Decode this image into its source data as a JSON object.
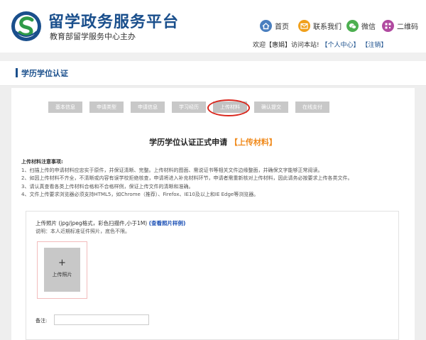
{
  "header": {
    "site_title": "留学政务服务平台",
    "site_subtitle": "教育部留学服务中心主办",
    "nav": [
      {
        "label": "首页",
        "icon": "home-icon",
        "color": "#4a7fbf"
      },
      {
        "label": "联系我们",
        "icon": "mail-icon",
        "color": "#f0a01c"
      },
      {
        "label": "微信",
        "icon": "wechat-icon",
        "color": "#4caf50"
      },
      {
        "label": "二维码",
        "icon": "qrcode-icon",
        "color": "#b04aa0"
      }
    ],
    "greeting": {
      "welcome": "欢迎【惠娟】访问本站!",
      "personal_center": "【个人中心】",
      "logout": "【注销】"
    }
  },
  "section_title": "学历学位认证",
  "steps": [
    "基本信息",
    "申请类型",
    "申请信息",
    "学习经历",
    "上传材料",
    "确认提交",
    "在线支付"
  ],
  "active_step": "上传材料",
  "main_title": {
    "prefix": "学历学位认证正式申请",
    "highlight": "【上传材料】"
  },
  "notes": {
    "heading": "上传材料注意事项:",
    "items": [
      "1、扫描上传的申请材料应忠实于原件，并保证清晰、完整。上传材料的图面、需说证书等相关文件边缘整面，并确保文字能够正常阅读。",
      "2、如因上传材料不齐全，不清晰或内容有误学校拒绝核查，申请将进入补充材料环节，申请者需重新核对上传材料，因此请务必按要求上传各类文件。",
      "3、请认真查看各类上传材料合格和不合格样例，保证上传文件的清晰和准确。",
      "4、文件上传要求浏览器必须支持HTML5，如Chrome（推荐）、Firefox、IE10及以上和IE Edge等浏览器。"
    ]
  },
  "upload": {
    "title": "上传照片 (jpg/jpeg格式，彩色扫描件,小于1M)",
    "sample_link": "(查看照片样例)",
    "description": "说明：本人近期标准证件照片，底色不限。",
    "plus": "+",
    "button_label": "上传照片"
  },
  "remark": {
    "label": "备注:",
    "value": ""
  }
}
